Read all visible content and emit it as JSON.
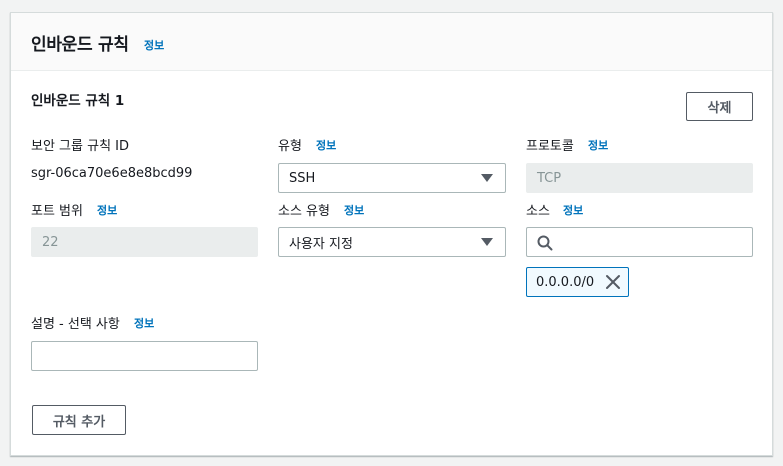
{
  "panel": {
    "title": "인바운드 규칙",
    "info": "정보"
  },
  "rule": {
    "title": "인바운드 규칙 1",
    "delete_label": "삭제",
    "sg_rule_id": {
      "label": "보안 그룹 규칙 ID",
      "value": "sgr-06ca70e6e8e8bcd99"
    },
    "type": {
      "label": "유형",
      "info": "정보",
      "value": "SSH"
    },
    "protocol": {
      "label": "프로토콜",
      "info": "정보",
      "value": "TCP"
    },
    "port_range": {
      "label": "포트 범위",
      "info": "정보",
      "value": "22"
    },
    "source_type": {
      "label": "소스 유형",
      "info": "정보",
      "value": "사용자 지정"
    },
    "source": {
      "label": "소스",
      "info": "정보",
      "search_value": "",
      "token": "0.0.0.0/0"
    },
    "description": {
      "label": "설명 - 선택 사항",
      "info": "정보",
      "value": ""
    }
  },
  "add_rule_label": "규칙 추가",
  "colors": {
    "link": "#0073bb",
    "border": "#aab7b8",
    "disabled_bg": "#eaeded",
    "token_border": "#0073bb",
    "token_bg": "#f1faff"
  },
  "icons": [
    "search-icon",
    "close-icon",
    "chevron-down-icon"
  ]
}
